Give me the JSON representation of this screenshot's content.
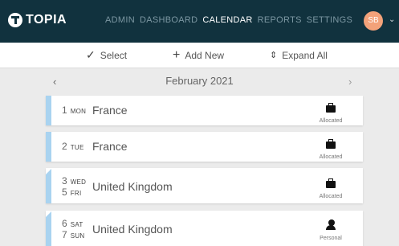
{
  "header": {
    "logo_text": "TOPIA",
    "nav": [
      {
        "label": "ADMIN",
        "active": false
      },
      {
        "label": "DASHBOARD",
        "active": false
      },
      {
        "label": "CALENDAR",
        "active": true
      },
      {
        "label": "REPORTS",
        "active": false
      },
      {
        "label": "SETTINGS",
        "active": false
      }
    ],
    "avatar_initials": "SB"
  },
  "toolbar": {
    "select_label": "Select",
    "add_label": "Add New",
    "expand_label": "Expand All"
  },
  "calendar": {
    "month": "February 2021",
    "prev_arrow": "‹",
    "next_arrow": "›",
    "entries": [
      {
        "dates": [
          {
            "day": "1",
            "weekday": "MON"
          }
        ],
        "place": "France",
        "kind": "Allocated",
        "kind_icon": "briefcase-icon"
      },
      {
        "dates": [
          {
            "day": "2",
            "weekday": "TUE"
          }
        ],
        "place": "France",
        "kind": "Allocated",
        "kind_icon": "briefcase-icon"
      },
      {
        "dates": [
          {
            "day": "3",
            "weekday": "WED"
          },
          {
            "day": "5",
            "weekday": "FRI"
          }
        ],
        "place": "United Kingdom",
        "kind": "Allocated",
        "kind_icon": "briefcase-icon"
      },
      {
        "dates": [
          {
            "day": "6",
            "weekday": "SAT"
          },
          {
            "day": "7",
            "weekday": "SUN"
          }
        ],
        "place": "United Kingdom",
        "kind": "Personal",
        "kind_icon": "person-pin-icon"
      }
    ]
  },
  "colors": {
    "header_bg": "#11323e",
    "stripe": "#a9d3f0",
    "avatar_bg": "#f3a27a"
  }
}
